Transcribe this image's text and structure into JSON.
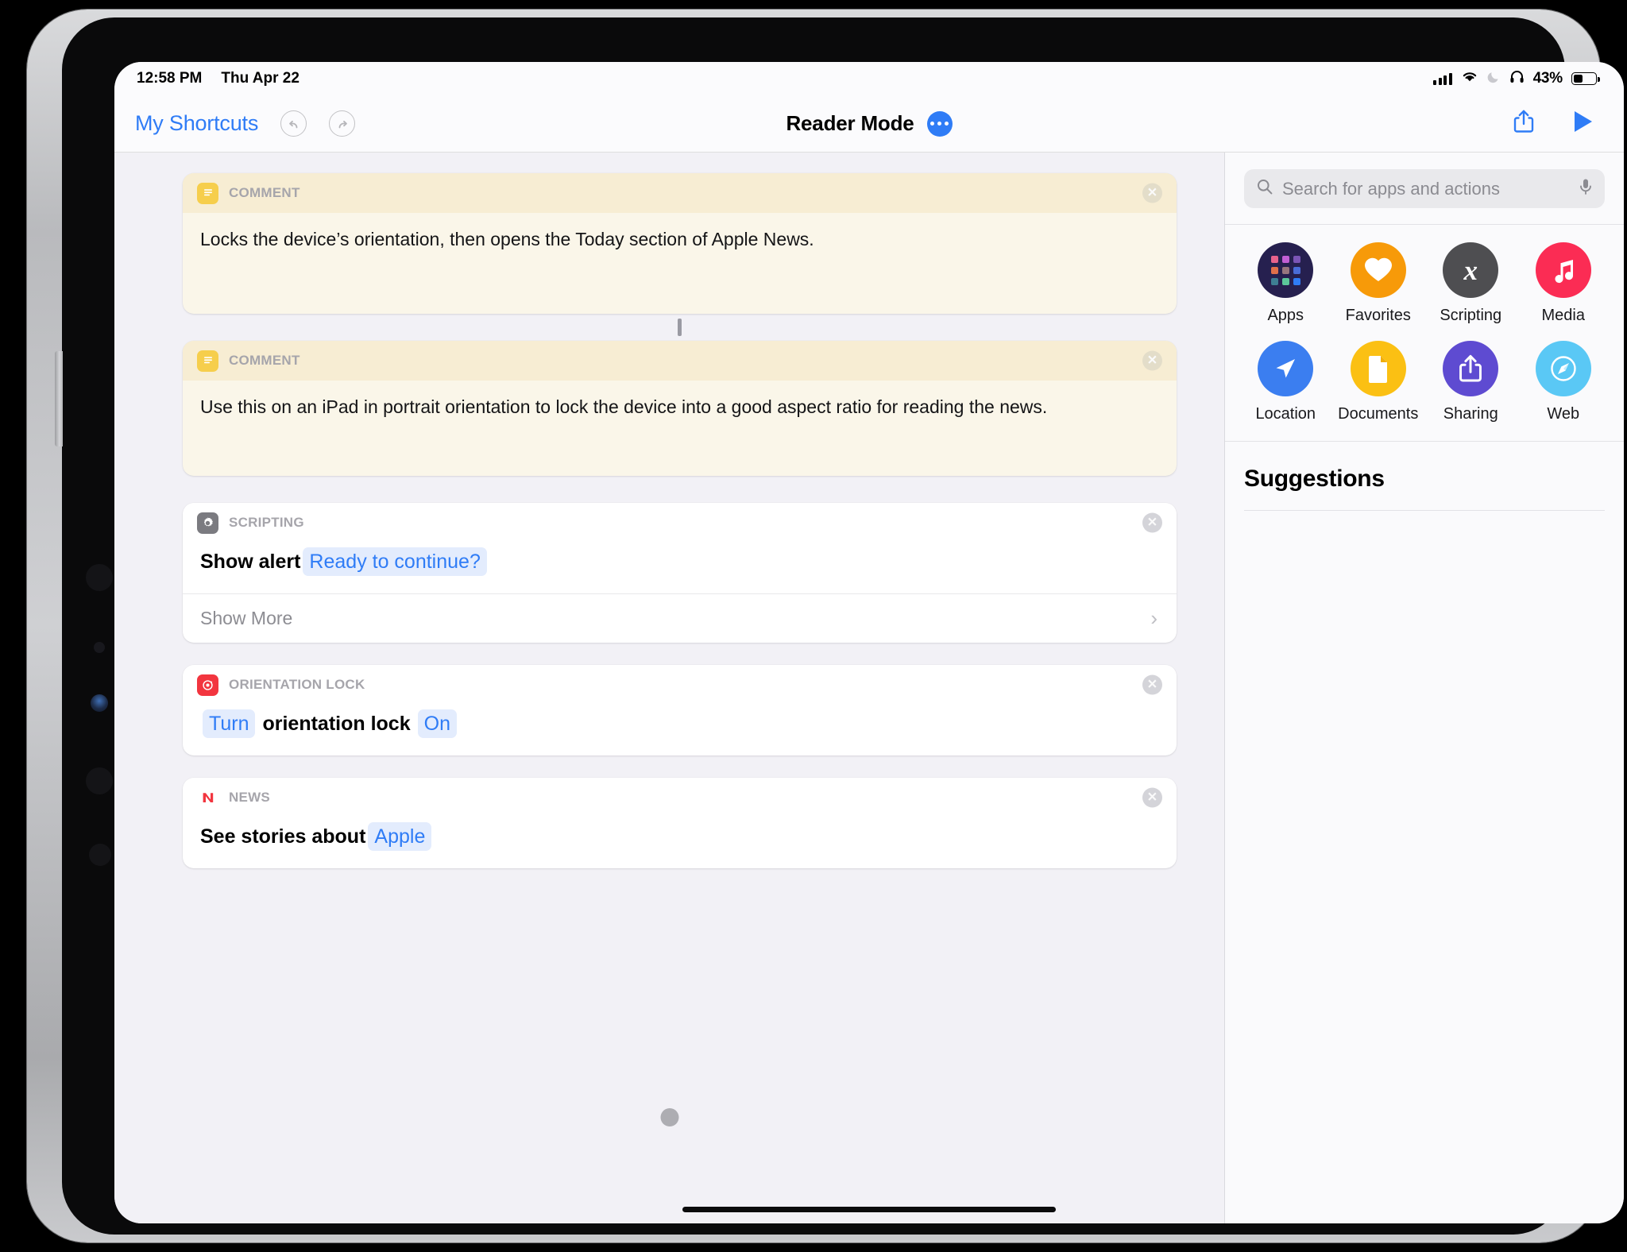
{
  "status_bar": {
    "time": "12:58 PM",
    "date": "Thu Apr 22",
    "battery_percent": "43%",
    "icons": [
      "cellular-signal-icon",
      "wifi-icon",
      "do-not-disturb-moon-icon",
      "headphones-icon",
      "battery-icon"
    ]
  },
  "nav": {
    "back_label": "My Shortcuts",
    "undo_icon": "undo-icon",
    "redo_icon": "redo-icon",
    "title": "Reader Mode",
    "more_icon": "ellipsis-icon",
    "share_icon": "share-icon",
    "run_icon": "play-icon"
  },
  "editor": {
    "actions": [
      {
        "type": "comment",
        "category": "COMMENT",
        "icon": "note-icon",
        "icon_color": "#f6ce4c",
        "text": "Locks the device’s orientation, then opens the Today section of Apple News.",
        "close_icon": "close-icon"
      },
      {
        "type": "comment",
        "category": "COMMENT",
        "icon": "note-icon",
        "icon_color": "#f6ce4c",
        "text": "Use this on an iPad in portrait orientation to lock the device into a good aspect ratio for reading the news.",
        "close_icon": "close-icon"
      },
      {
        "type": "action",
        "category": "SCRIPTING",
        "icon": "gear-icon",
        "icon_color": "#7b7b80",
        "label": "Show alert",
        "parameter": "Ready to continue?",
        "show_more_label": "Show More",
        "close_icon": "close-icon"
      },
      {
        "type": "action",
        "category": "ORIENTATION LOCK",
        "icon": "orientation-lock-icon",
        "icon_color": "#f2353f",
        "verb": "Turn",
        "label": "orientation lock",
        "parameter": "On",
        "close_icon": "close-icon"
      },
      {
        "type": "action",
        "category": "NEWS",
        "icon": "apple-news-icon",
        "icon_color": "#f2353f",
        "label": "See stories about",
        "parameter": "Apple",
        "close_icon": "close-icon"
      }
    ]
  },
  "right_panel": {
    "search": {
      "placeholder": "Search for apps and actions",
      "search_icon": "search-icon",
      "mic_icon": "microphone-icon"
    },
    "categories": [
      {
        "label": "Apps",
        "icon": "apps-grid-icon",
        "color": "#26204f"
      },
      {
        "label": "Favorites",
        "icon": "heart-icon",
        "color": "#f79a09"
      },
      {
        "label": "Scripting",
        "icon": "variable-x-icon",
        "color": "#4e4e51"
      },
      {
        "label": "Media",
        "icon": "music-note-icon",
        "color": "#fb2c54"
      },
      {
        "label": "Location",
        "icon": "navigation-arrow-icon",
        "color": "#3b7ef0"
      },
      {
        "label": "Documents",
        "icon": "document-icon",
        "color": "#fbc013"
      },
      {
        "label": "Sharing",
        "icon": "share-icon",
        "color": "#5e4bd1"
      },
      {
        "label": "Web",
        "icon": "compass-icon",
        "color": "#5ac8f5"
      }
    ],
    "suggestions_title": "Suggestions"
  },
  "colors": {
    "accent_blue": "#2f7cf6",
    "comment_bg": "#faf6e9",
    "comment_header": "#f7edd3",
    "editor_bg": "#f2f1f6",
    "panel_bg": "#fafafc"
  }
}
